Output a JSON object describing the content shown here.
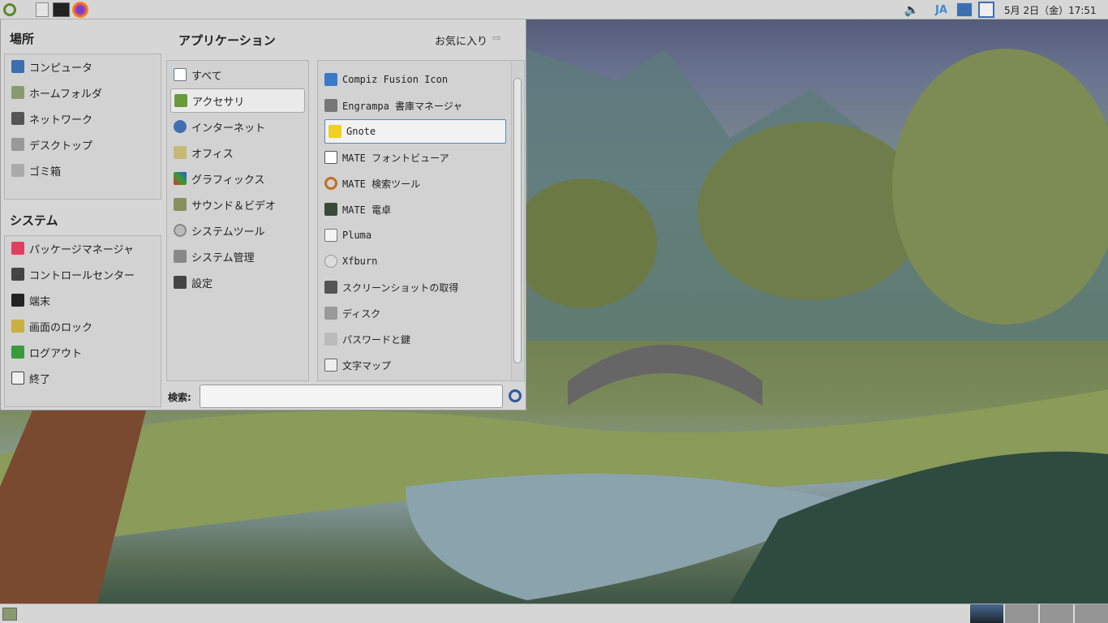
{
  "top_panel": {
    "keyboard": "JA",
    "clock": "5月 2日（金）17:51"
  },
  "menu": {
    "places_title": "場所",
    "places": [
      "コンピュータ",
      "ホームフォルダ",
      "ネットワーク",
      "デスクトップ",
      "ゴミ箱"
    ],
    "system_title": "システム",
    "system": [
      "パッケージマネージャ",
      "コントロールセンター",
      "端末",
      "画面のロック",
      "ログアウト",
      "終了"
    ],
    "apps_title": "アプリケーション",
    "favorites": "お気に入り",
    "categories": [
      "すべて",
      "アクセサリ",
      "インターネット",
      "オフィス",
      "グラフィックス",
      "サウンド＆ビデオ",
      "システムツール",
      "システム管理",
      "設定"
    ],
    "apps": [
      "Compiz Fusion Icon",
      "Engrampa 書庫マネージャ",
      "Gnote",
      "MATE フォントビューア",
      "MATE 検索ツール",
      "MATE 電卓",
      "Pluma",
      "Xfburn",
      "スクリーンショットの取得",
      "ディスク",
      "パスワードと鍵",
      "文字マップ"
    ],
    "search_label": "検索:",
    "search_value": ""
  },
  "colors": {
    "panel": "#d6d6d6",
    "accent": "#5b84b8"
  }
}
